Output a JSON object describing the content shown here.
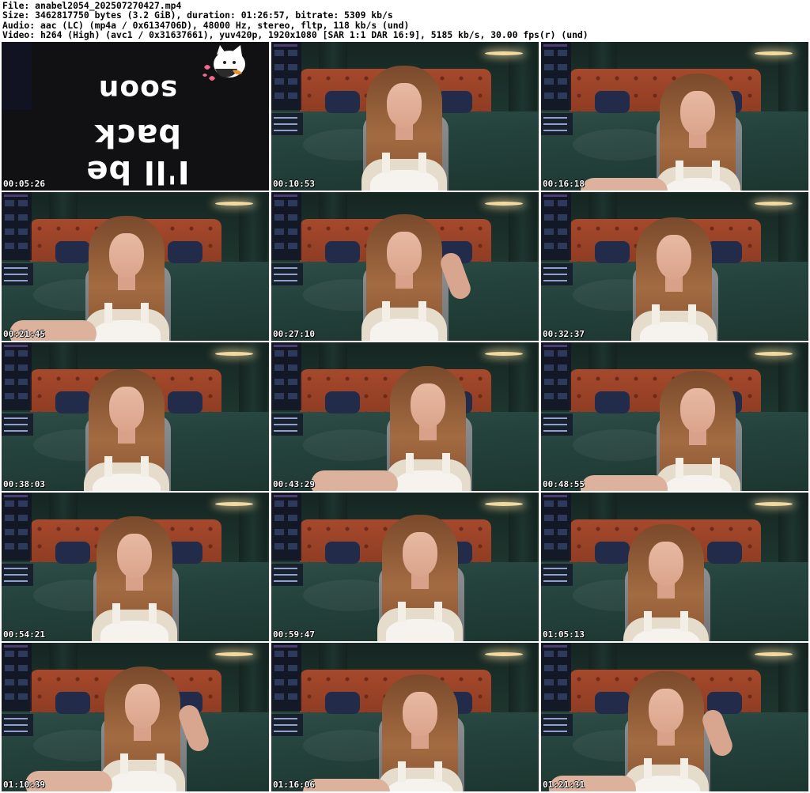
{
  "header": {
    "file": "File: anabel2054_202507270427.mp4",
    "size": "Size: 3462817750 bytes (3.2 GiB), duration: 01:26:57, bitrate: 5309 kb/s",
    "audio": "Audio: aac (LC) (mp4a / 0x6134706D), 48000 Hz, stereo, fltp, 118 kb/s (und)",
    "video": "Video: h264 (High) (avc1 / 0x31637661), yuv420p, 1920x1080 [SAR 1:1 DAR 16:9], 5185 kb/s, 30.00 fps(r) (und)"
  },
  "intro": {
    "line1": "soon",
    "line2": "I'll be back"
  },
  "thumbnails": [
    {
      "timestamp": "00:05:26"
    },
    {
      "timestamp": "00:10:53"
    },
    {
      "timestamp": "00:16:18"
    },
    {
      "timestamp": "00:21:45"
    },
    {
      "timestamp": "00:27:10"
    },
    {
      "timestamp": "00:32:37"
    },
    {
      "timestamp": "00:38:03"
    },
    {
      "timestamp": "00:43:29"
    },
    {
      "timestamp": "00:48:55"
    },
    {
      "timestamp": "00:54:21"
    },
    {
      "timestamp": "00:59:47"
    },
    {
      "timestamp": "01:05:13"
    },
    {
      "timestamp": "01:10:39"
    },
    {
      "timestamp": "01:16:06"
    },
    {
      "timestamp": "01:21:31"
    }
  ]
}
